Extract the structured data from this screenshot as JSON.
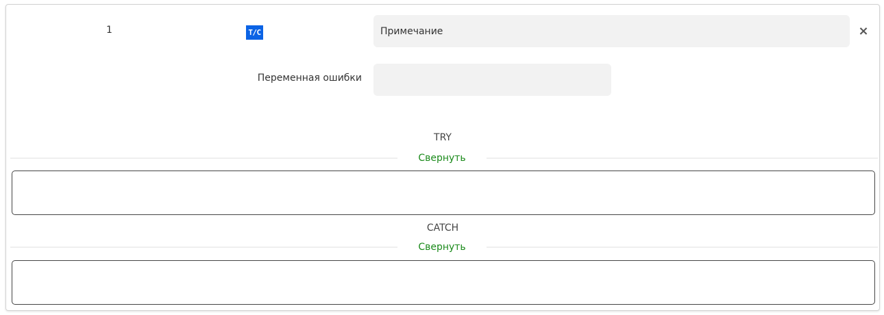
{
  "step": {
    "number": "1",
    "badge": "T/C",
    "note_placeholder": "Примечание",
    "close_label": "×"
  },
  "error_variable": {
    "label": "Переменная ошибки",
    "value": ""
  },
  "try_section": {
    "title": "TRY",
    "collapse_label": "Свернуть"
  },
  "catch_section": {
    "title": "CATCH",
    "collapse_label": "Свернуть"
  },
  "colors": {
    "badge": "#0b63e5",
    "collapse_link": "#1a8a1a",
    "input_background": "#f2f2f2"
  }
}
